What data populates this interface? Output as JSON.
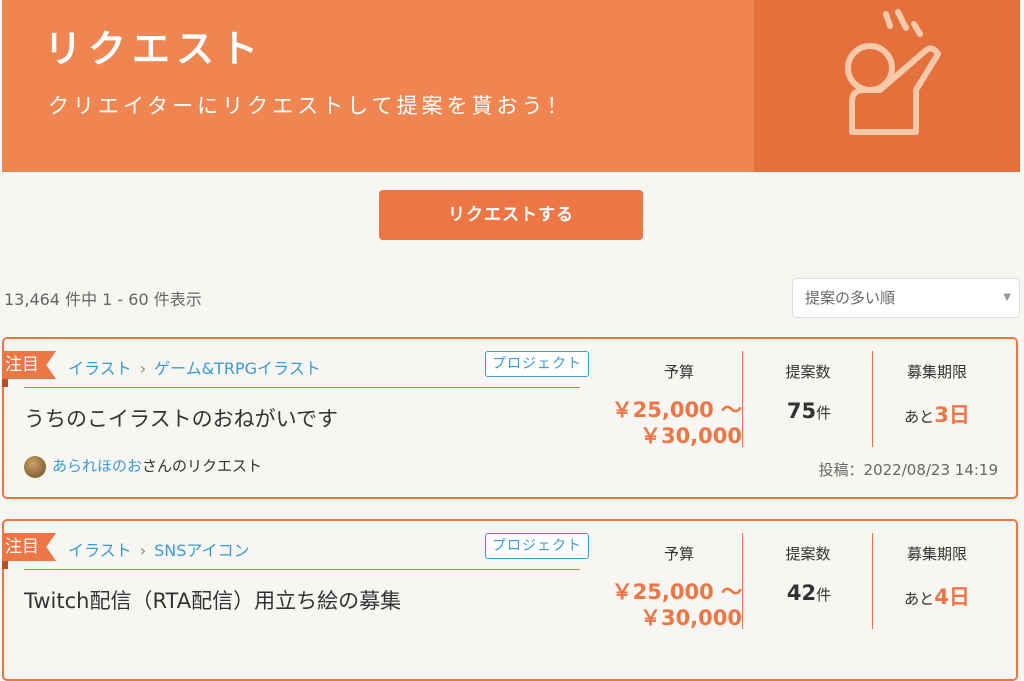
{
  "hero": {
    "title": "リクエスト",
    "subtitle": "クリエイターにリクエストして提案を貰おう！"
  },
  "request_button": "リクエストする",
  "result_count": "13,464 件中 1 - 60 件表示",
  "sort": {
    "selected": "提案の多い順"
  },
  "columns": {
    "budget": "予算",
    "proposals": "提案数",
    "deadline": "募集期限"
  },
  "cards": [
    {
      "badge": "注目",
      "category": "イラスト",
      "subcategory": "ゲーム&TRPGイラスト",
      "tag": "プロジェクト",
      "title": "うちのこイラストのおねがいです",
      "author_name": "あられほのお",
      "author_suffix": "さんのリクエスト",
      "budget_line1": "￥25,000 〜",
      "budget_line2": "￥30,000",
      "proposals_num": "75",
      "proposals_unit": "件",
      "deadline_prefix": "あと",
      "deadline_num": "3",
      "deadline_unit": "日",
      "posted": "投稿：2022/08/23 14:19"
    },
    {
      "badge": "注目",
      "category": "イラスト",
      "subcategory": "SNSアイコン",
      "tag": "プロジェクト",
      "title": "Twitch配信（RTA配信）用立ち絵の募集",
      "budget_line1": "￥25,000 〜",
      "budget_line2": "￥30,000",
      "proposals_num": "42",
      "proposals_unit": "件",
      "deadline_prefix": "あと",
      "deadline_num": "4",
      "deadline_unit": "日"
    }
  ]
}
